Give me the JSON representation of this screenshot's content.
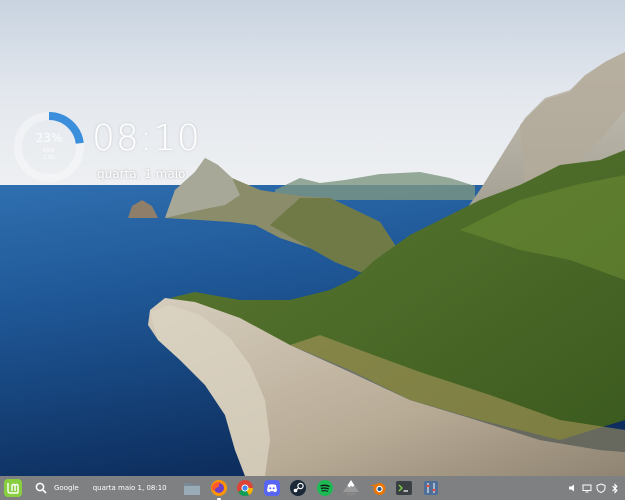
{
  "widget": {
    "percent": "23%",
    "percent_value": 0.23,
    "resource_label": "RAM",
    "resource_value": "1.9G",
    "time": "08:10",
    "date": "quarta, 1 maio"
  },
  "panel": {
    "menu_icon": "linux-mint-menu-icon",
    "search_icon": "search-icon",
    "search_label": "Google",
    "clock": "quarta maio 1, 08:10",
    "dock": [
      {
        "name": "files-icon",
        "active": false
      },
      {
        "name": "firefox-icon",
        "active": true
      },
      {
        "name": "chrome-icon",
        "active": false
      },
      {
        "name": "discord-icon",
        "active": false
      },
      {
        "name": "steam-icon",
        "active": false
      },
      {
        "name": "spotify-icon",
        "active": false
      },
      {
        "name": "inkscape-icon",
        "active": false
      },
      {
        "name": "blender-icon",
        "active": false
      },
      {
        "name": "terminal-icon",
        "active": false
      },
      {
        "name": "mixer-icon",
        "active": false
      }
    ],
    "tray": [
      "volume-icon",
      "display-icon",
      "shield-icon",
      "bluetooth-icon"
    ]
  },
  "colors": {
    "ring_fill": "#3a8edb",
    "ring_track": "rgba(255,255,255,0.35)",
    "mint_green": "#87cf3e",
    "sea": "#1d4a86",
    "sky": "#dfe6ee"
  }
}
